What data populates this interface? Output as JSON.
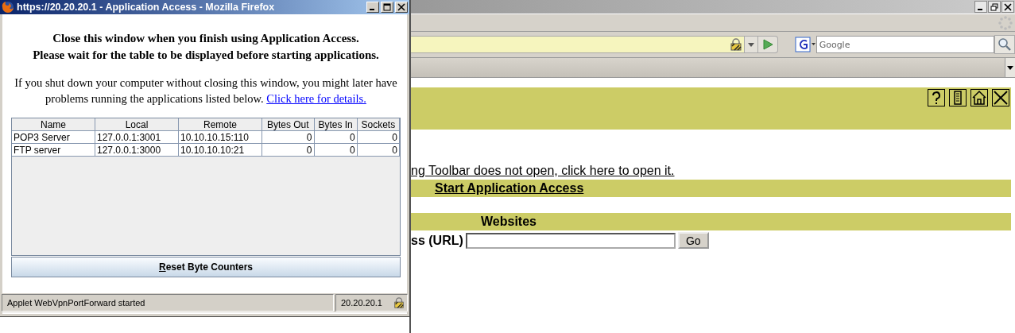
{
  "browser": {
    "search": {
      "placeholder": "Google"
    },
    "toolbar_link": "ng Toolbar does not open, click here to open it.",
    "start_link": "Start Application Access",
    "websites_heading": "Websites",
    "url_label": "ss (URL)",
    "go_button": "Go"
  },
  "popup": {
    "title": "https://20.20.20.1 - Application Access - Mozilla Firefox",
    "heading_lines": [
      "Close this window when you finish using Application Access.",
      "Please wait for the table to be displayed before starting applications."
    ],
    "notice": "If you shut down your computer without closing this window, you might later have problems running the applications listed below.",
    "notice_link": "Click here for details.",
    "table": {
      "columns": [
        {
          "label": "Name",
          "kind": "text"
        },
        {
          "label": "Local",
          "kind": "text"
        },
        {
          "label": "Remote",
          "kind": "text"
        },
        {
          "label": "Bytes Out",
          "kind": "number"
        },
        {
          "label": "Bytes In",
          "kind": "number"
        },
        {
          "label": "Sockets",
          "kind": "number"
        }
      ],
      "rows": [
        [
          "POP3 Server",
          "127.0.0.1:3001",
          "10.10.10.15:110",
          "0",
          "0",
          "0"
        ],
        [
          "FTP server",
          "127.0.0.1:3000",
          "10.10.10.10:21",
          "0",
          "0",
          "0"
        ]
      ]
    },
    "reset_button": "Reset Byte Counters",
    "status_bar": {
      "message": "Applet WebVpnPortForward started",
      "host": "20.20.20.1"
    }
  }
}
